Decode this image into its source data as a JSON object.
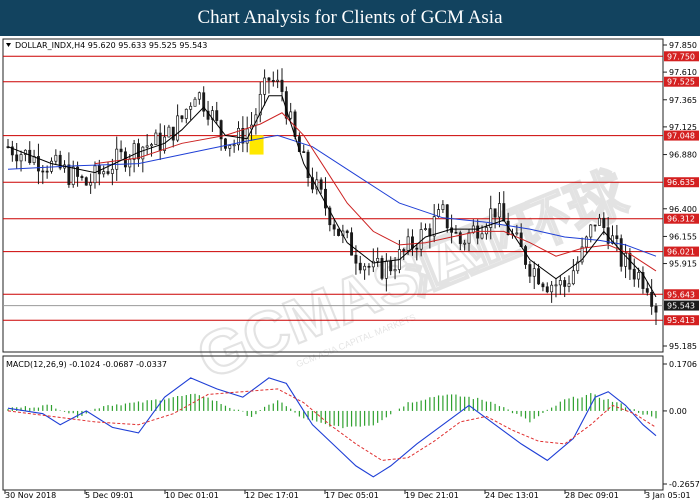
{
  "header": {
    "title": "Chart Analysis for Clients of GCM Asia"
  },
  "watermark": {
    "text": "GCMASIA",
    "chinese": "汇亚环球",
    "small": "GCM ASIA CAPITAL MARKETS"
  },
  "colors": {
    "header_bg": "#12435f",
    "candle": "#1a1a1a",
    "ma_fast": "#000000",
    "ma_mid": "#cc2222",
    "ma_slow": "#1f3fd6",
    "hline": "#cc0000",
    "hline_label_bg": "#d42020",
    "price_label_bg": "#1a1a1a",
    "macd_hist": "#2ea02e",
    "macd_line": "#1f3fd6",
    "signal_line": "#e03030",
    "highlight": "#ffe800"
  },
  "chart_data": {
    "type": "candlestick",
    "title": "DOLLAR_INDX,H4  95.620 95.633 95.525 95.543",
    "symbol": "DOLLAR_INDX,H4",
    "ohlc_readout": [
      "95.620",
      "95.633",
      "95.525",
      "95.543"
    ],
    "last_price": 95.543,
    "ylim": [
      95.185,
      97.85
    ],
    "y_ticks": [
      "97.850",
      "97.610",
      "97.365",
      "97.125",
      "96.880",
      "96.400",
      "96.155",
      "95.915",
      "95.185"
    ],
    "horizontal_levels": [
      97.75,
      97.525,
      97.048,
      96.635,
      96.312,
      96.021,
      95.643,
      95.413
    ],
    "horizontal_level_labels": [
      "97.750",
      "97.525",
      "97.048",
      "96.635",
      "96.312",
      "96.021",
      "95.643",
      "95.413"
    ],
    "price_label": "95.543",
    "x_ticks": [
      "30 Nov 2018",
      "5 Dec 09:01",
      "10 Dec 01:01",
      "12 Dec 17:01",
      "17 Dec 05:01",
      "19 Dec 21:01",
      "24 Dec 13:01",
      "28 Dec 09:01",
      "3 Jan 05:01"
    ],
    "close_path": [
      [
        0,
        96.95
      ],
      [
        6,
        96.85
      ],
      [
        12,
        96.75
      ],
      [
        18,
        96.62
      ],
      [
        24,
        96.8
      ],
      [
        30,
        96.95
      ],
      [
        36,
        97.0
      ],
      [
        40,
        97.2
      ],
      [
        43,
        97.45
      ],
      [
        46,
        97.3
      ],
      [
        49,
        97.05
      ],
      [
        52,
        96.98
      ],
      [
        56,
        97.15
      ],
      [
        60,
        97.55
      ],
      [
        63,
        97.45
      ],
      [
        66,
        97.0
      ],
      [
        69,
        96.7
      ],
      [
        72,
        96.5
      ],
      [
        76,
        96.2
      ],
      [
        80,
        96.0
      ],
      [
        84,
        95.85
      ],
      [
        88,
        95.9
      ],
      [
        92,
        96.05
      ],
      [
        96,
        96.2
      ],
      [
        100,
        96.35
      ],
      [
        104,
        96.1
      ],
      [
        108,
        96.25
      ],
      [
        112,
        96.4
      ],
      [
        116,
        96.15
      ],
      [
        120,
        95.9
      ],
      [
        124,
        95.75
      ],
      [
        128,
        95.72
      ],
      [
        132,
        96.0
      ],
      [
        135,
        96.3
      ],
      [
        138,
        96.2
      ],
      [
        141,
        95.95
      ],
      [
        144,
        95.85
      ],
      [
        147,
        95.75
      ],
      [
        149,
        95.54
      ]
    ],
    "candle_count": 150,
    "ma_fast": [
      [
        0,
        96.95
      ],
      [
        10,
        96.8
      ],
      [
        20,
        96.72
      ],
      [
        30,
        96.9
      ],
      [
        36,
        96.98
      ],
      [
        40,
        97.1
      ],
      [
        45,
        97.3
      ],
      [
        50,
        97.05
      ],
      [
        55,
        97.02
      ],
      [
        60,
        97.4
      ],
      [
        63,
        97.4
      ],
      [
        68,
        96.8
      ],
      [
        73,
        96.45
      ],
      [
        78,
        96.1
      ],
      [
        84,
        95.92
      ],
      [
        90,
        95.95
      ],
      [
        96,
        96.15
      ],
      [
        102,
        96.22
      ],
      [
        108,
        96.22
      ],
      [
        114,
        96.3
      ],
      [
        120,
        95.95
      ],
      [
        126,
        95.78
      ],
      [
        132,
        95.95
      ],
      [
        137,
        96.2
      ],
      [
        142,
        95.98
      ],
      [
        146,
        95.82
      ],
      [
        149,
        95.62
      ]
    ],
    "ma_mid": [
      [
        20,
        96.8
      ],
      [
        30,
        96.85
      ],
      [
        40,
        96.98
      ],
      [
        50,
        97.05
      ],
      [
        58,
        97.15
      ],
      [
        63,
        97.25
      ],
      [
        68,
        97.05
      ],
      [
        73,
        96.75
      ],
      [
        78,
        96.45
      ],
      [
        84,
        96.2
      ],
      [
        90,
        96.08
      ],
      [
        96,
        96.1
      ],
      [
        102,
        96.15
      ],
      [
        108,
        96.2
      ],
      [
        114,
        96.2
      ],
      [
        120,
        96.1
      ],
      [
        126,
        95.98
      ],
      [
        132,
        96.05
      ],
      [
        138,
        96.08
      ],
      [
        143,
        96.0
      ],
      [
        149,
        95.85
      ]
    ],
    "ma_slow": [
      [
        0,
        96.75
      ],
      [
        15,
        96.78
      ],
      [
        30,
        96.8
      ],
      [
        45,
        96.92
      ],
      [
        55,
        97.0
      ],
      [
        62,
        97.05
      ],
      [
        70,
        96.95
      ],
      [
        80,
        96.7
      ],
      [
        90,
        96.45
      ],
      [
        100,
        96.32
      ],
      [
        110,
        96.28
      ],
      [
        120,
        96.22
      ],
      [
        128,
        96.15
      ],
      [
        136,
        96.12
      ],
      [
        142,
        96.08
      ],
      [
        149,
        95.98
      ]
    ],
    "macd": {
      "label": "MACD(12,26,9)  -0.1024  -0.0687  -0.0337",
      "params": "MACD(12,26,9)",
      "values": [
        "-0.1024",
        "-0.0687",
        "-0.0337"
      ],
      "ylim": [
        -0.2657,
        0.1706
      ],
      "y_ticks": [
        "0.1706",
        "0.00",
        "-0.2657"
      ],
      "macd_path": [
        [
          0,
          0.01
        ],
        [
          8,
          -0.01
        ],
        [
          12,
          -0.05
        ],
        [
          18,
          0.0
        ],
        [
          24,
          -0.06
        ],
        [
          30,
          -0.08
        ],
        [
          36,
          0.05
        ],
        [
          42,
          0.12
        ],
        [
          48,
          0.08
        ],
        [
          54,
          0.05
        ],
        [
          60,
          0.12
        ],
        [
          64,
          0.1
        ],
        [
          70,
          -0.05
        ],
        [
          76,
          -0.14
        ],
        [
          80,
          -0.2
        ],
        [
          84,
          -0.24
        ],
        [
          88,
          -0.2
        ],
        [
          94,
          -0.12
        ],
        [
          100,
          -0.05
        ],
        [
          106,
          0.02
        ],
        [
          112,
          -0.05
        ],
        [
          118,
          -0.12
        ],
        [
          124,
          -0.18
        ],
        [
          130,
          -0.1
        ],
        [
          135,
          0.05
        ],
        [
          138,
          0.07
        ],
        [
          142,
          0.02
        ],
        [
          146,
          -0.05
        ],
        [
          149,
          -0.09
        ]
      ],
      "signal_path": [
        [
          0,
          0.0
        ],
        [
          10,
          -0.02
        ],
        [
          20,
          -0.04
        ],
        [
          30,
          -0.05
        ],
        [
          38,
          -0.01
        ],
        [
          46,
          0.06
        ],
        [
          54,
          0.07
        ],
        [
          62,
          0.08
        ],
        [
          68,
          0.03
        ],
        [
          74,
          -0.05
        ],
        [
          80,
          -0.12
        ],
        [
          86,
          -0.18
        ],
        [
          92,
          -0.17
        ],
        [
          98,
          -0.11
        ],
        [
          104,
          -0.04
        ],
        [
          110,
          -0.02
        ],
        [
          116,
          -0.07
        ],
        [
          122,
          -0.11
        ],
        [
          128,
          -0.12
        ],
        [
          134,
          -0.05
        ],
        [
          139,
          0.02
        ],
        [
          144,
          -0.01
        ],
        [
          149,
          -0.06
        ]
      ],
      "histogram_path": [
        [
          0,
          0.01
        ],
        [
          10,
          0.02
        ],
        [
          16,
          -0.02
        ],
        [
          22,
          0.02
        ],
        [
          30,
          0.03
        ],
        [
          38,
          0.05
        ],
        [
          44,
          0.06
        ],
        [
          50,
          0.02
        ],
        [
          56,
          -0.02
        ],
        [
          62,
          0.04
        ],
        [
          68,
          -0.03
        ],
        [
          76,
          -0.06
        ],
        [
          84,
          -0.05
        ],
        [
          92,
          0.03
        ],
        [
          100,
          0.06
        ],
        [
          106,
          0.05
        ],
        [
          112,
          0.03
        ],
        [
          120,
          -0.04
        ],
        [
          128,
          0.04
        ],
        [
          134,
          0.06
        ],
        [
          140,
          0.03
        ],
        [
          149,
          -0.03
        ]
      ]
    }
  }
}
